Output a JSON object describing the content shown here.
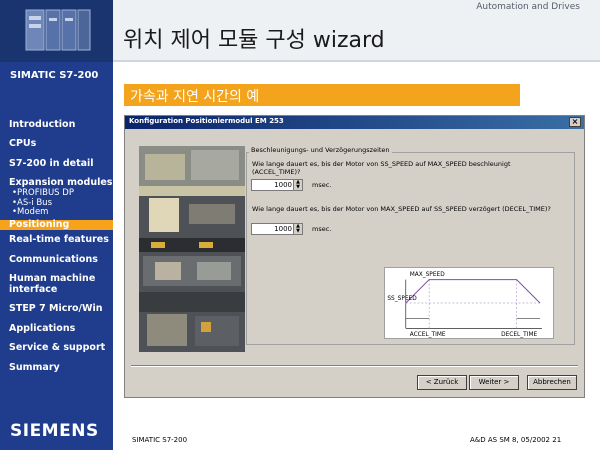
{
  "sidebar": {
    "product_name": "SIMATIC S7-200",
    "nav": [
      {
        "label": "Introduction"
      },
      {
        "label": "CPUs"
      },
      {
        "label": "S7-200 in detail"
      },
      {
        "label": "Expansion modules"
      },
      {
        "label": "•PROFIBUS DP"
      },
      {
        "label": "•AS-i Bus"
      },
      {
        "label": "•Modem"
      },
      {
        "label": "Positioning"
      },
      {
        "label": "Real-time features"
      },
      {
        "label": "Communications"
      },
      {
        "label": "Human machine"
      },
      {
        "label": "interface"
      },
      {
        "label": "STEP 7 Micro/Win"
      },
      {
        "label": "Applications"
      },
      {
        "label": "Service & support"
      },
      {
        "label": "Summary"
      }
    ],
    "active_item": "Positioning",
    "logo": "SIEMENS"
  },
  "header": {
    "brand_line": "Automation and Drives",
    "title": "위치 제어 모듈 구성 wizard"
  },
  "subtitle": "가속과 지연 시간의 예",
  "dialog": {
    "title": "Konfiguration Positioniermodul EM 253",
    "close_glyph": "×",
    "group_title": "Beschleunigungs- und Verzögerungszeiten",
    "accel_question_line1": "Wie lange dauert es, bis der Motor von SS_SPEED auf MAX_SPEED beschleunigt",
    "accel_question_line2": "(ACCEL_TIME)?",
    "accel_value": "1000",
    "decel_question": "Wie lange dauert es, bis der Motor von MAX_SPEED auf SS_SPEED verzögert (DECEL_TIME)?",
    "decel_value": "1000",
    "unit": "msec.",
    "diagram": {
      "max_speed_label": "MAX_SPEED",
      "ss_speed_label": "SS_SPEED",
      "accel_label": "ACCEL_TIME",
      "decel_label": "DECEL_TIME"
    },
    "buttons": {
      "back": "< Zurück",
      "next": "Weiter >",
      "cancel": "Abbrechen"
    }
  },
  "footer": {
    "left": "SIMATIC S7-200",
    "right": "A&D AS SM 8, 05/2002  21"
  },
  "colors": {
    "sidebar_bg": "#1f3d8c",
    "accent_orange": "#f3a41c",
    "dialog_titlebar": "#0a246a",
    "dialog_bg": "#d4d0c8"
  }
}
